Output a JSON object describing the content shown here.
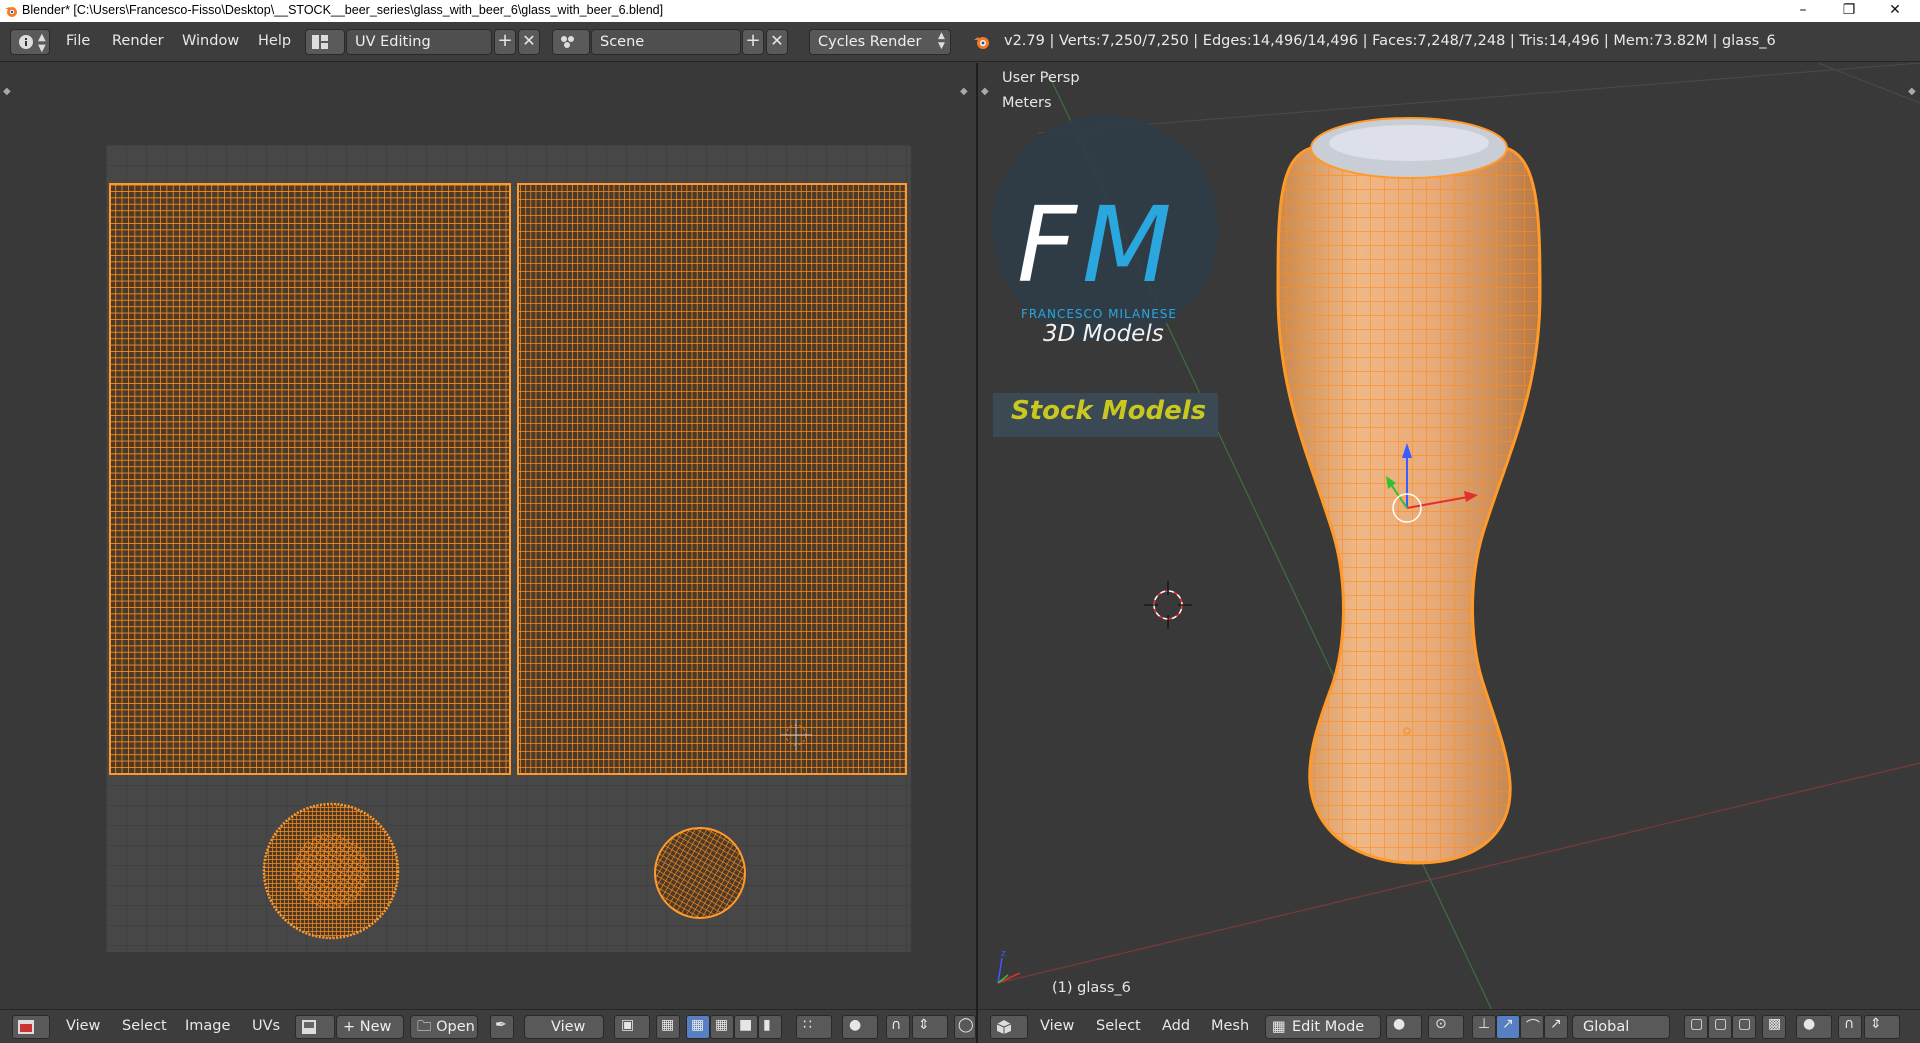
{
  "window": {
    "title": "Blender* [C:\\Users\\Francesco-Fisso\\Desktop\\__STOCK__beer_series\\glass_with_beer_6\\glass_with_beer_6.blend]"
  },
  "info_header": {
    "menus": [
      "File",
      "Render",
      "Window",
      "Help"
    ],
    "screen_layout": "UV Editing",
    "scene": "Scene",
    "render_engine": "Cycles Render",
    "stats": "v2.79 | Verts:7,250/7,250 | Edges:14,496/14,496 | Faces:7,248/7,248 | Tris:14,496 | Mem:73.82M | glass_6"
  },
  "view3d": {
    "view_name": "User Persp",
    "units": "Meters",
    "object_label": "(1) glass_6",
    "logo": {
      "letters_f": "F",
      "letters_m": "M",
      "company": "FRANCESCO MILANESE",
      "tagline": "3D Models",
      "banner": "Stock Models"
    }
  },
  "uv_header": {
    "menus": [
      "View",
      "Select",
      "Image",
      "UVs"
    ],
    "new_label": "New",
    "open_label": "Open",
    "view_label": "View"
  },
  "view3d_header": {
    "menus": [
      "View",
      "Select",
      "Add",
      "Mesh"
    ],
    "mode": "Edit Mode",
    "orientation": "Global"
  },
  "colors": {
    "accent_orange": "#ff8c1a",
    "background": "#393939",
    "header": "#3d3d3d",
    "logo_blue": "#2aa7de",
    "logo_banner": "#c8c820"
  }
}
